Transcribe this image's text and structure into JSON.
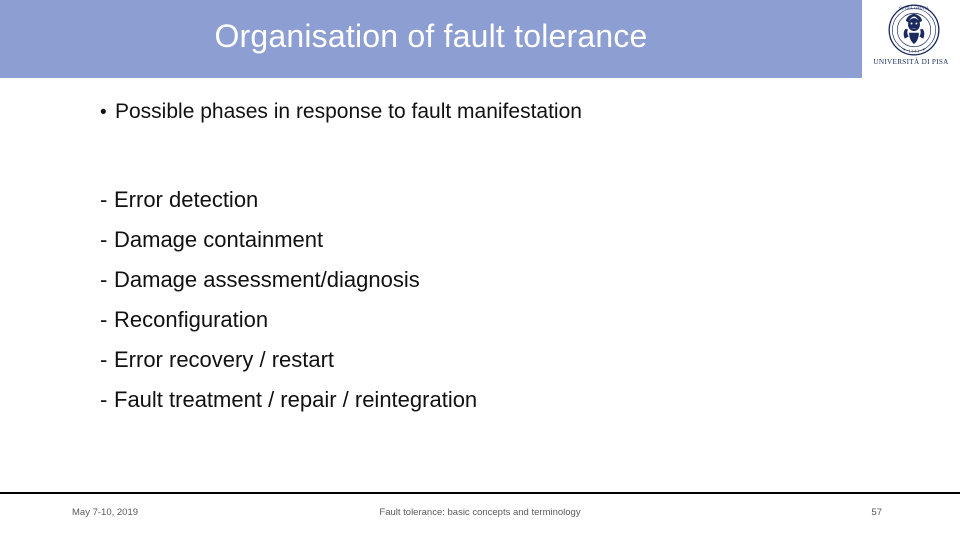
{
  "slide": {
    "title": "Organisation of fault tolerance",
    "background_color": "#ffffff",
    "header_band_color": "#8d9ed2",
    "title_color": "#ffffff"
  },
  "logo": {
    "icon": "university-seal-icon",
    "caption": "UNIVERSITÀ DI PISA",
    "caption_color": "#1b2a5e"
  },
  "body": {
    "bullet": {
      "marker": "•",
      "text": "Possible phases in response to fault manifestation"
    },
    "phases": [
      {
        "marker": "-",
        "label": "Error detection"
      },
      {
        "marker": "-",
        "label": "Damage containment"
      },
      {
        "marker": "-",
        "label": "Damage assessment/diagnosis"
      },
      {
        "marker": "-",
        "label": "Reconfiguration"
      },
      {
        "marker": "-",
        "label": "Error recovery / restart"
      },
      {
        "marker": "-",
        "label": "Fault treatment / repair / reintegration"
      }
    ]
  },
  "footer": {
    "date": "May 7-10, 2019",
    "center": "Fault tolerance: basic concepts and terminology",
    "page_number": "57"
  }
}
